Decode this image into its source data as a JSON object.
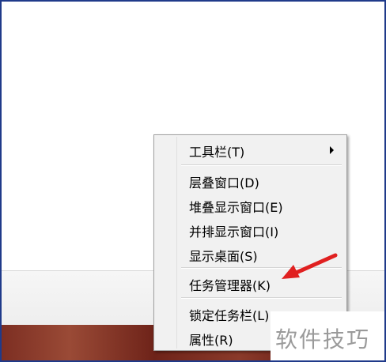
{
  "context_menu": {
    "items": [
      {
        "label": "工具栏(T)",
        "has_submenu": true
      },
      {
        "label": "层叠窗口(D)"
      },
      {
        "label": "堆叠显示窗口(E)"
      },
      {
        "label": "并排显示窗口(I)"
      },
      {
        "label": "显示桌面(S)"
      },
      {
        "label": "任务管理器(K)"
      },
      {
        "label": "锁定任务栏(L)"
      },
      {
        "label": "属性(R)"
      }
    ]
  },
  "annotation": {
    "arrow_color": "#e02020",
    "points_to": "任务管理器(K)"
  },
  "watermark": {
    "text": "软件技巧"
  },
  "colors": {
    "frame_border": "#1f3a8a",
    "menu_background": "#f1f1f1",
    "desktop_wallpaper": "#7c2e22"
  }
}
